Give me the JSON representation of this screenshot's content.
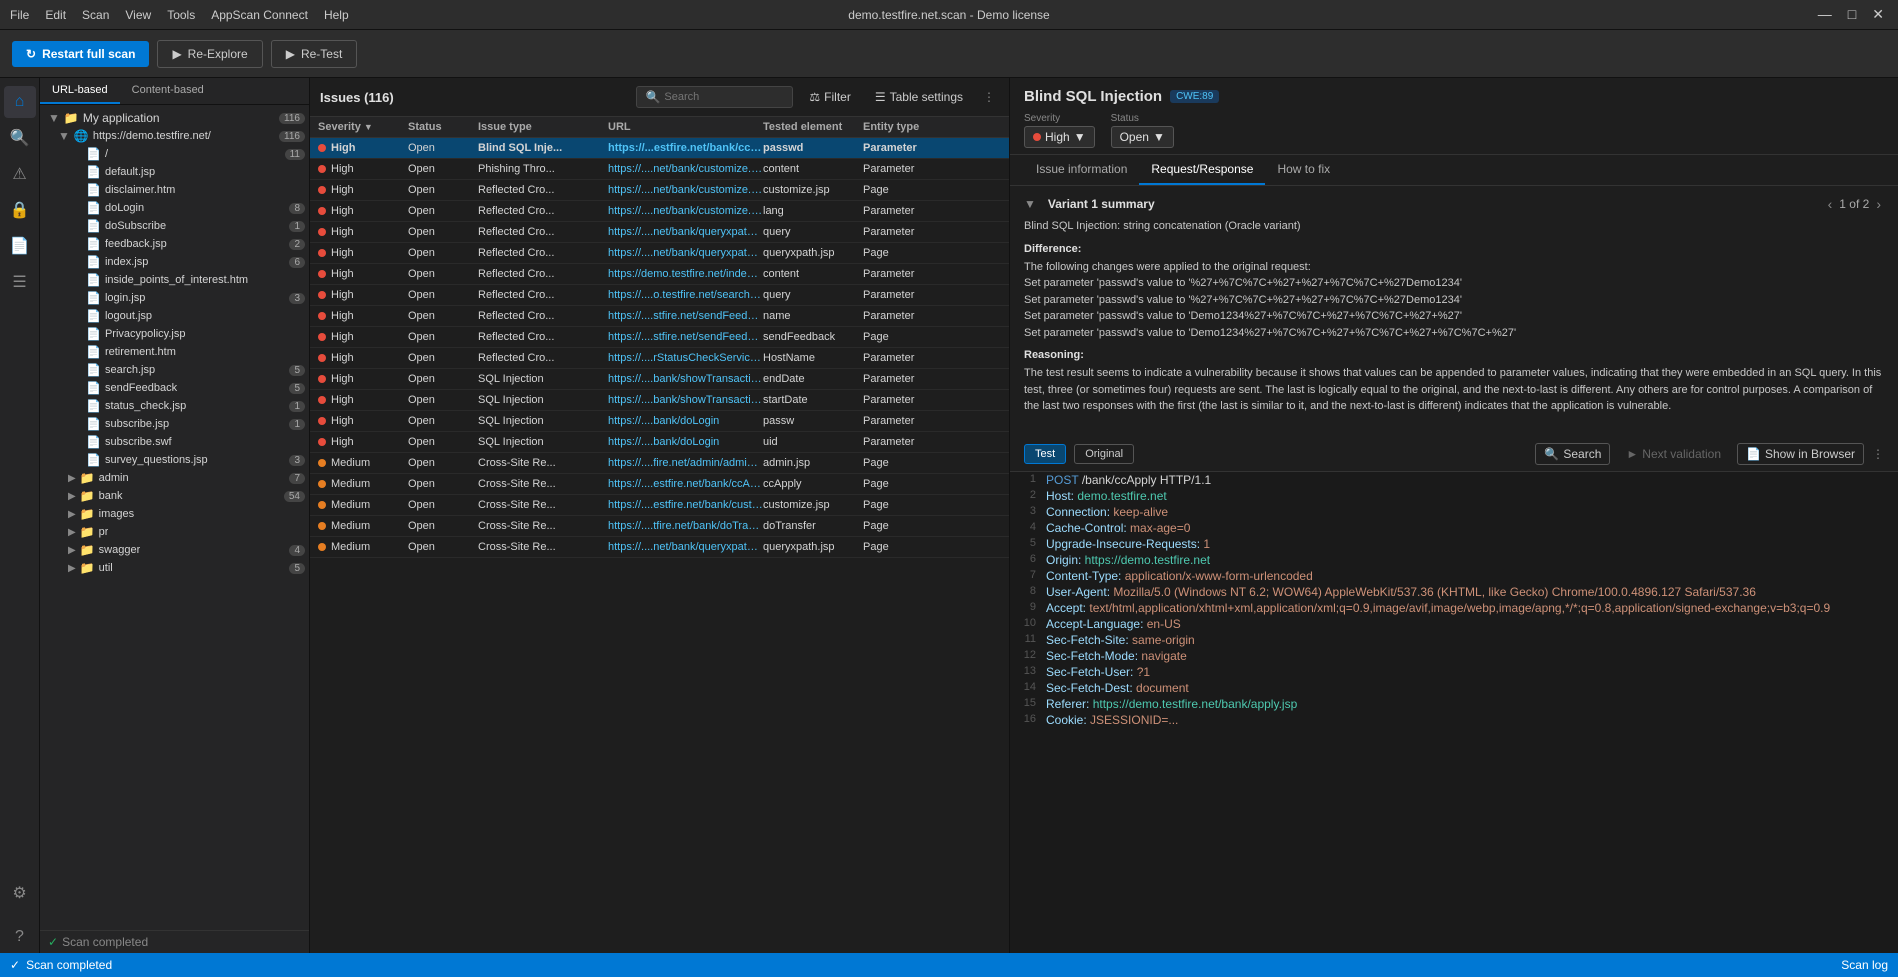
{
  "titlebar": {
    "title": "demo.testfire.net.scan - Demo license",
    "menu_items": [
      "File",
      "Edit",
      "Scan",
      "View",
      "Tools",
      "AppScan Connect",
      "Help"
    ]
  },
  "toolbar": {
    "restart_label": "Restart full scan",
    "reexplore_label": "Re-Explore",
    "retest_label": "Re-Test"
  },
  "file_tree": {
    "tabs": [
      "URL-based",
      "Content-based"
    ],
    "active_tab": "URL-based",
    "root": {
      "label": "My application",
      "count": 116,
      "children": [
        {
          "label": "https://demo.testfire.net/",
          "count": 116,
          "expanded": true,
          "children": [
            {
              "label": "/",
              "count": 11
            },
            {
              "label": "default.jsp",
              "count": 0
            },
            {
              "label": "disclaimer.htm",
              "count": 0
            },
            {
              "label": "doLogin",
              "count": 8
            },
            {
              "label": "doSubscribe",
              "count": 1
            },
            {
              "label": "feedback.jsp",
              "count": 2
            },
            {
              "label": "index.jsp",
              "count": 6
            },
            {
              "label": "inside_points_of_interest.htm",
              "count": 0
            },
            {
              "label": "login.jsp",
              "count": 3
            },
            {
              "label": "logout.jsp",
              "count": 0
            },
            {
              "label": "Privacypolicy.jsp",
              "count": 0
            },
            {
              "label": "retirement.htm",
              "count": 0
            },
            {
              "label": "search.jsp",
              "count": 5
            },
            {
              "label": "sendFeedback",
              "count": 5
            },
            {
              "label": "status_check.jsp",
              "count": 1
            },
            {
              "label": "subscribe.jsp",
              "count": 1
            },
            {
              "label": "subscribe.swf",
              "count": 0
            },
            {
              "label": "survey_questions.jsp",
              "count": 3
            },
            {
              "label": "admin",
              "count": 7,
              "folder": true
            },
            {
              "label": "bank",
              "count": 54,
              "folder": true
            },
            {
              "label": "images",
              "count": 0,
              "folder": true
            },
            {
              "label": "pr",
              "count": 0,
              "folder": true
            },
            {
              "label": "swagger",
              "count": 4,
              "folder": true
            },
            {
              "label": "util",
              "count": 5,
              "folder": true
            }
          ]
        }
      ]
    },
    "footer": "Scan completed"
  },
  "issues": {
    "title": "Issues",
    "count": 116,
    "search_placeholder": "Search",
    "columns": [
      "Severity",
      "",
      "Status",
      "Issue type",
      "URL",
      "Tested element",
      "Entity type"
    ],
    "rows": [
      {
        "severity": "High",
        "severity_type": "high",
        "status": "Open",
        "issue_type": "Blind SQL Inje...",
        "url": "https://...estfire.net/bank/ccApply",
        "tested_element": "passwd",
        "entity_type": "Parameter",
        "bold": true,
        "selected": true
      },
      {
        "severity": "High",
        "severity_type": "high",
        "status": "Open",
        "issue_type": "Phishing Thro...",
        "url": "https://....net/bank/customize.jsp",
        "tested_element": "content",
        "entity_type": "Parameter"
      },
      {
        "severity": "High",
        "severity_type": "high",
        "status": "Open",
        "issue_type": "Reflected Cro...",
        "url": "https://....net/bank/customize.jsp",
        "tested_element": "customize.jsp",
        "entity_type": "Page"
      },
      {
        "severity": "High",
        "severity_type": "high",
        "status": "Open",
        "issue_type": "Reflected Cro...",
        "url": "https://....net/bank/customize.jsp",
        "tested_element": "lang",
        "entity_type": "Parameter"
      },
      {
        "severity": "High",
        "severity_type": "high",
        "status": "Open",
        "issue_type": "Reflected Cro...",
        "url": "https://....net/bank/queryxpath.jsp",
        "tested_element": "query",
        "entity_type": "Parameter"
      },
      {
        "severity": "High",
        "severity_type": "high",
        "status": "Open",
        "issue_type": "Reflected Cro...",
        "url": "https://....net/bank/queryxpath.jsp",
        "tested_element": "queryxpath.jsp",
        "entity_type": "Page"
      },
      {
        "severity": "High",
        "severity_type": "high",
        "status": "Open",
        "issue_type": "Reflected Cro...",
        "url": "https://demo.testfire.net/index.jsp",
        "tested_element": "content",
        "entity_type": "Parameter",
        "has_more": true
      },
      {
        "severity": "High",
        "severity_type": "high",
        "status": "Open",
        "issue_type": "Reflected Cro...",
        "url": "https://....o.testfire.net/search.jsp",
        "tested_element": "query",
        "entity_type": "Parameter"
      },
      {
        "severity": "High",
        "severity_type": "high",
        "status": "Open",
        "issue_type": "Reflected Cro...",
        "url": "https://....stfire.net/sendFeedback",
        "tested_element": "name",
        "entity_type": "Parameter"
      },
      {
        "severity": "High",
        "severity_type": "high",
        "status": "Open",
        "issue_type": "Reflected Cro...",
        "url": "https://....stfire.net/sendFeedback",
        "tested_element": "sendFeedback",
        "entity_type": "Page"
      },
      {
        "severity": "High",
        "severity_type": "high",
        "status": "Open",
        "issue_type": "Reflected Cro...",
        "url": "https://....rStatusCheckService.jsp",
        "tested_element": "HostName",
        "entity_type": "Parameter"
      },
      {
        "severity": "High",
        "severity_type": "high",
        "status": "Open",
        "issue_type": "SQL Injection",
        "url": "https://....bank/showTransactions",
        "tested_element": "endDate",
        "entity_type": "Parameter"
      },
      {
        "severity": "High",
        "severity_type": "high",
        "status": "Open",
        "issue_type": "SQL Injection",
        "url": "https://....bank/showTransactions",
        "tested_element": "startDate",
        "entity_type": "Parameter"
      },
      {
        "severity": "High",
        "severity_type": "high",
        "status": "Open",
        "issue_type": "SQL Injection",
        "url": "https://....bank/doLogin",
        "tested_element": "passw",
        "entity_type": "Parameter"
      },
      {
        "severity": "High",
        "severity_type": "high",
        "status": "Open",
        "issue_type": "SQL Injection",
        "url": "https://....bank/doLogin",
        "tested_element": "uid",
        "entity_type": "Parameter"
      },
      {
        "severity": "Medium",
        "severity_type": "medium",
        "status": "Open",
        "issue_type": "Cross-Site Re...",
        "url": "https://....fire.net/admin/admin.jsp",
        "tested_element": "admin.jsp",
        "entity_type": "Page"
      },
      {
        "severity": "Medium",
        "severity_type": "medium",
        "status": "Open",
        "issue_type": "Cross-Site Re...",
        "url": "https://....estfire.net/bank/ccApply",
        "tested_element": "ccApply",
        "entity_type": "Page"
      },
      {
        "severity": "Medium",
        "severity_type": "medium",
        "status": "Open",
        "issue_type": "Cross-Site Re...",
        "url": "https://....estfire.net/bank/customize.jsp",
        "tested_element": "customize.jsp",
        "entity_type": "Page"
      },
      {
        "severity": "Medium",
        "severity_type": "medium",
        "status": "Open",
        "issue_type": "Cross-Site Re...",
        "url": "https://....tfire.net/bank/doTransfer",
        "tested_element": "doTransfer",
        "entity_type": "Page"
      },
      {
        "severity": "Medium",
        "severity_type": "medium",
        "status": "Open",
        "issue_type": "Cross-Site Re...",
        "url": "https://....net/bank/queryxpath.jsp",
        "tested_element": "queryxpath.jsp",
        "entity_type": "Page"
      }
    ]
  },
  "detail": {
    "title": "Blind SQL Injection",
    "cwe": "CWE:89",
    "severity_label": "Severity",
    "severity_value": "High",
    "status_label": "Status",
    "status_value": "Open",
    "tabs": [
      "Issue information",
      "Request/Response",
      "How to fix"
    ],
    "active_tab": "Request/Response",
    "variant_summary": {
      "title": "Variant 1 summary",
      "page_current": 1,
      "page_total": 2,
      "subtitle": "Blind SQL Injection: string concatenation (Oracle variant)",
      "difference_title": "Difference:",
      "difference_text": "The following changes were applied to the original request:\nSet parameter 'passwd's value to '%27+%7C%7C+%27+%27+%7C%7C+%27Demo1234'\nSet parameter 'passwd's value to '%27+%7C%7C+%27+%27+%7C%7C+%27Demo1234'\nSet parameter 'passwd's value to 'Demo1234%27+%7C%7C+%27+%7C%7C+%27+%27'\nSet parameter 'passwd's value to 'Demo1234%27+%7C%7C+%27+%7C%7C+%27+%7C%7C+%27'",
      "reasoning_title": "Reasoning:",
      "reasoning_text": "The test result seems to indicate a vulnerability because it shows that values can be appended to parameter values, indicating that they were embedded in an SQL query. In this test, three (or sometimes four) requests are sent. The last is logically equal to the original, and the next-to-last is different. Any others are for control purposes. A comparison of the last two responses with the first (the last is similar to it, and the next-to-last is different) indicates that the application is vulnerable."
    },
    "req_resp": {
      "toggle_test": "Test",
      "toggle_original": "Original",
      "search_label": "Search",
      "next_validation_label": "Next validation",
      "show_browser_label": "Show in Browser",
      "code_lines": [
        {
          "num": 1,
          "content": "POST /bank/ccApply HTTP/1.1"
        },
        {
          "num": 2,
          "content": "Host: demo.testfire.net"
        },
        {
          "num": 3,
          "content": "Connection: keep-alive"
        },
        {
          "num": 4,
          "content": "Cache-Control: max-age=0"
        },
        {
          "num": 5,
          "content": "Upgrade-Insecure-Requests: 1"
        },
        {
          "num": 6,
          "content": "Origin: https://demo.testfire.net"
        },
        {
          "num": 7,
          "content": "Content-Type: application/x-www-form-urlencoded"
        },
        {
          "num": 8,
          "content": "User-Agent: Mozilla/5.0 (Windows NT 6.2; WOW64) AppleWebKit/537.36 (KHTML, like Gecko) Chrome/100.0.4896.127 Safari/537.36"
        },
        {
          "num": 9,
          "content": "Accept: text/html,application/xhtml+xml,application/xml;q=0.9,image/avif,image/webp,image/apng,*/*;q=0.8,application/signed-exchange;v=b3;q=0.9"
        },
        {
          "num": 10,
          "content": "Accept-Language: en-US"
        },
        {
          "num": 11,
          "content": "Sec-Fetch-Site: same-origin"
        },
        {
          "num": 12,
          "content": "Sec-Fetch-Mode: navigate"
        },
        {
          "num": 13,
          "content": "Sec-Fetch-User: ?1"
        },
        {
          "num": 14,
          "content": "Sec-Fetch-Dest: document"
        },
        {
          "num": 15,
          "content": "Referer: https://demo.testfire.net/bank/apply.jsp"
        },
        {
          "num": 16,
          "content": "Cookie: JSESSIONID=..."
        }
      ]
    }
  },
  "statusbar": {
    "scan_completed": "Scan completed",
    "scan_log": "Scan log"
  }
}
